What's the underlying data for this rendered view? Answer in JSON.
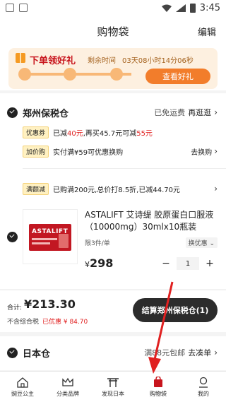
{
  "status_bar": {
    "time": "3:45"
  },
  "header": {
    "title": "购物袋",
    "edit_label": "编辑"
  },
  "promo": {
    "title": "下单领好礼",
    "time_label": "剩余时间",
    "countdown": "03天08小时14分06秒",
    "button_label": "查看好礼"
  },
  "warehouse": {
    "name": "郑州保税仓",
    "shipping_note": "已免运费",
    "go_label": "再逛逛",
    "coupon": {
      "tag": "优惠券",
      "text_a": "已减",
      "amount_a": "40元",
      "text_b": ",再买45.7元可减",
      "amount_b": "55元"
    },
    "addon": {
      "tag": "加价购",
      "text": "实付满¥59可优惠换购",
      "action": "去换购"
    },
    "full_reduce": {
      "tag": "满额减",
      "text": "已购满200元,总价打8.5折,已减44.70元"
    }
  },
  "product": {
    "image_brand": "ASTALIFT",
    "name": "ASTALIFT 艾诗缇 胶原蛋白口服液（10000mg）30mlx10瓶装",
    "limit": "限3件/单",
    "discount_label": "换优惠",
    "price_symbol": "¥",
    "price": "298",
    "quantity": "1",
    "minus": "−",
    "plus": "+"
  },
  "total": {
    "label": "合计:",
    "amount": "¥213.30",
    "tax_note": "不含综合税",
    "discount_note": "已优惠 ¥ 84.70"
  },
  "checkout": {
    "label": "结算郑州保税仓(1)"
  },
  "warehouse2": {
    "name": "日本仓",
    "shipping_note": "满88元包邮",
    "go_label": "去凑单"
  },
  "tabs": [
    {
      "label": "豌豆公主",
      "icon": "home-icon"
    },
    {
      "label": "分类品牌",
      "icon": "crown-icon"
    },
    {
      "label": "发现日本",
      "icon": "torii-icon"
    },
    {
      "label": "购物袋",
      "icon": "bag-icon"
    },
    {
      "label": "我的",
      "icon": "user-icon"
    }
  ],
  "colors": {
    "accent_red": "#e02020",
    "promo_orange": "#f27d2b",
    "checkout_dark": "#2c2c2c",
    "active_tab": "#c8151d"
  }
}
